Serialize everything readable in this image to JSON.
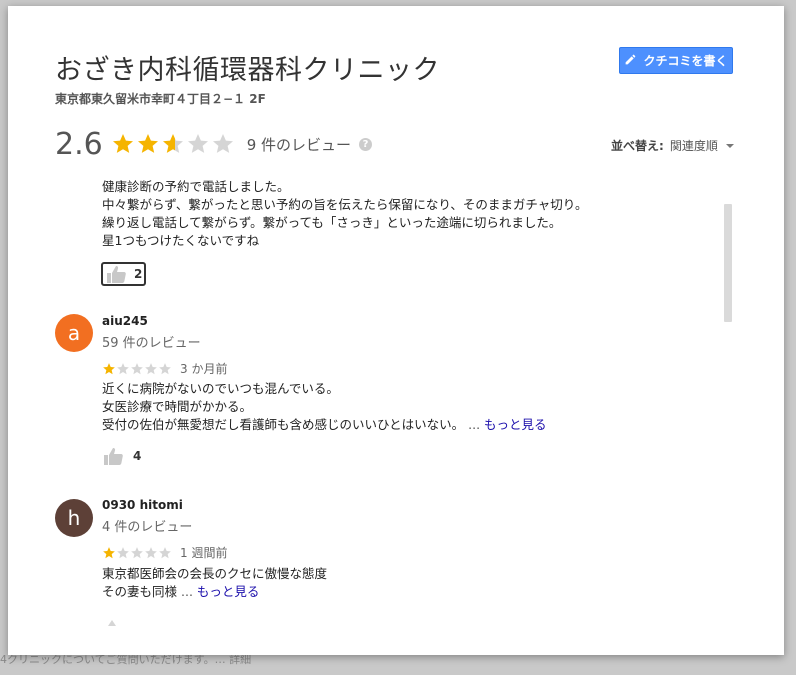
{
  "place": {
    "title": "おざき内科循環器科クリニック",
    "address": "東京都東久留米市幸町４丁目２−１ 2F"
  },
  "actions": {
    "write_review_label": "クチコミを書く"
  },
  "summary": {
    "rating": "2.6",
    "rating_value": 2.6,
    "review_count_label": "9 件のレビュー",
    "help_glyph": "?"
  },
  "sort": {
    "label": "並べ替え:",
    "selected": "関連度順"
  },
  "colors": {
    "star_filled": "#f5b400",
    "star_empty": "#d5d5d5",
    "accent_blue": "#4d90fe",
    "link": "#1a0dab"
  },
  "reviews": [
    {
      "lines": [
        "健康診断の予約で電話しました。",
        "中々繋がらず、繋がったと思い予約の旨を伝えたら保留になり、そのままガチャ切り。",
        "繰り返し電話して繋がらず。繋がっても「さっき」といった途端に切られました。",
        "星1つもつけたくないですね"
      ],
      "likes": "2"
    },
    {
      "avatar_letter": "a",
      "avatar_color": "#f26f21",
      "name": "aiu245",
      "count_label": "59 件のレビュー",
      "stars": 1,
      "time": "3 か月前",
      "lines": [
        "近くに病院がないのでいつも混んでいる。",
        "女医診療で時間がかかる。",
        "受付の佐伯が無愛想だし看護師も含め感じのいいひとはいない。"
      ],
      "ellipsis": "...",
      "more_label": "もっと見る",
      "likes": "4"
    },
    {
      "avatar_letter": "h",
      "avatar_color": "#5d4037",
      "name": "0930 hitomi",
      "count_label": "4 件のレビュー",
      "stars": 1,
      "time": "1 週間前",
      "lines": [
        "東京都医師会の会長のクセに傲慢な態度",
        "その妻も同様"
      ],
      "ellipsis": "...",
      "more_label": "もっと見る"
    }
  ],
  "backdrop": {
    "text": "4クリニックについてご質問いただけます。… 詳細"
  }
}
